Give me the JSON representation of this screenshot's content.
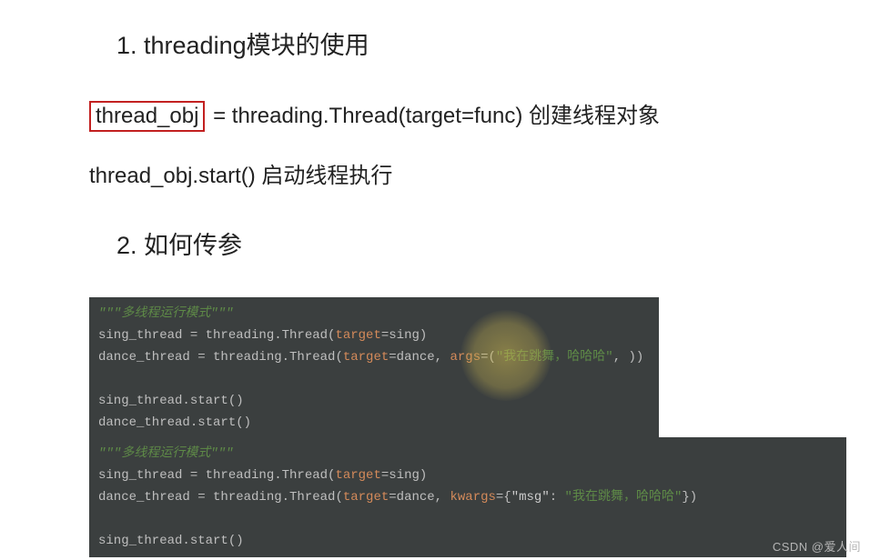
{
  "section1": {
    "title": "1. threading模块的使用",
    "line1": {
      "boxed": "thread_obj",
      "rest": " = threading.Thread(target=func)  创建线程对象"
    },
    "line2": "thread_obj.start() 启动线程执行"
  },
  "section2": {
    "title": "2. 如何传参",
    "code_a": {
      "docstring": "\"\"\"多线程运行模式\"\"\"",
      "l1a": "sing_thread = threading.Thread(",
      "l1_kw": "target",
      "l1b": "=sing)",
      "l2a": "dance_thread = threading.Thread(",
      "l2_kw1": "target",
      "l2b": "=dance, ",
      "l2_kw2": "args",
      "l2c": "=(",
      "l2_str": "\"我在跳舞，哈哈哈\"",
      "l2d": ", ))",
      "l4": "sing_thread.start()",
      "l5": "dance_thread.start()"
    },
    "code_b": {
      "docstring": "\"\"\"多线程运行模式\"\"\"",
      "l1a": "sing_thread = threading.Thread(",
      "l1_kw": "target",
      "l1b": "=sing)",
      "l2a": "dance_thread = threading.Thread(",
      "l2_kw1": "target",
      "l2b": "=dance, ",
      "l2_kw2": "kwargs",
      "l2c": "={",
      "l2_key": "\"msg\"",
      "l2d": ": ",
      "l2_val": "\"我在跳舞，哈哈哈\"",
      "l2e": "})",
      "l4": "sing_thread.start()"
    }
  },
  "watermark": "CSDN @爱人间"
}
